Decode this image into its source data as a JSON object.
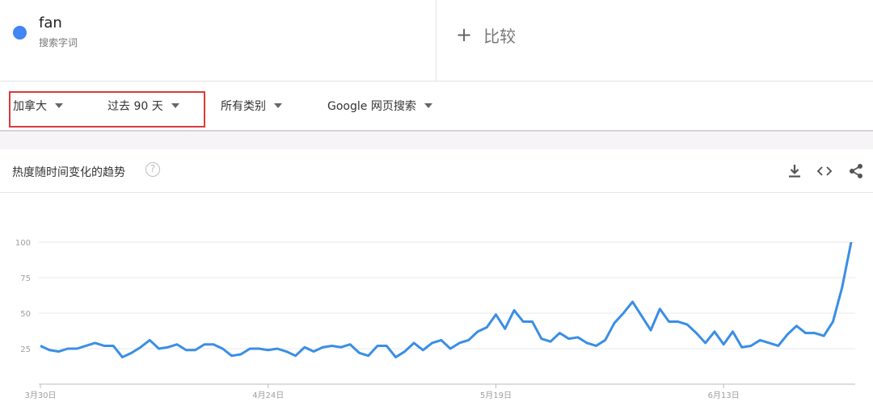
{
  "search_term": {
    "name": "fan",
    "subtitle": "搜索字词",
    "color": "#4285f4"
  },
  "compare": {
    "plus": "+",
    "label": "比较"
  },
  "filters": {
    "region": "加拿大",
    "time_range": "过去 90 天",
    "category": "所有类别",
    "search_type": "Google 网页搜索"
  },
  "card": {
    "title": "热度随时间变化的趋势",
    "help_symbol": "?",
    "icons": [
      "download-icon",
      "embed-icon",
      "share-icon"
    ]
  },
  "chart_data": {
    "type": "line",
    "ylim": [
      0,
      100
    ],
    "yticks": [
      25,
      50,
      75,
      100
    ],
    "x_tick_labels": [
      "3月30日",
      "4月24日",
      "5月19日",
      "6月13日"
    ],
    "x_tick_indices": [
      0,
      25,
      50,
      75
    ],
    "series": [
      {
        "color": "#3a8ee6",
        "values": [
          27,
          24,
          23,
          25,
          25,
          27,
          29,
          27,
          27,
          19,
          22,
          26,
          31,
          25,
          26,
          28,
          24,
          24,
          28,
          28,
          25,
          20,
          21,
          25,
          25,
          24,
          25,
          23,
          20,
          26,
          23,
          26,
          27,
          26,
          28,
          22,
          20,
          27,
          27,
          19,
          23,
          29,
          24,
          29,
          31,
          25,
          29,
          31,
          37,
          40,
          49,
          39,
          52,
          44,
          44,
          32,
          30,
          36,
          32,
          33,
          29,
          27,
          31,
          43,
          50,
          58,
          48,
          38,
          53,
          44,
          44,
          42,
          36,
          29,
          37,
          28,
          37,
          26,
          27,
          31,
          29,
          27,
          35,
          41,
          36,
          36,
          34,
          44,
          68,
          100
        ]
      }
    ]
  }
}
